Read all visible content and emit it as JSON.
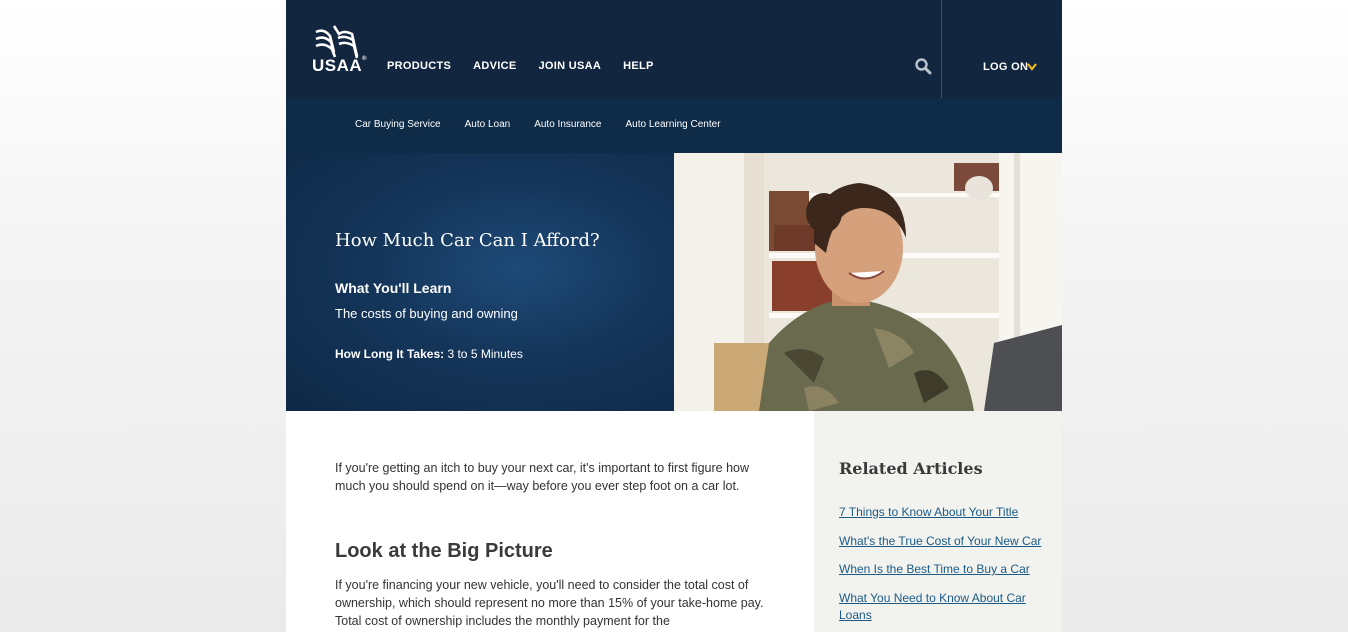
{
  "brand": {
    "name": "USAA",
    "registered": "®"
  },
  "header": {
    "nav": [
      "PRODUCTS",
      "ADVICE",
      "JOIN USAA",
      "HELP"
    ],
    "search_icon": "search-icon",
    "logon_label": "LOG ON",
    "accent": "#f2b71e"
  },
  "subnav": {
    "items": [
      "Car Buying Service",
      "Auto Loan",
      "Auto Insurance",
      "Auto Learning Center"
    ]
  },
  "hero": {
    "title": "How Much Car Can I Afford?",
    "learn_heading": "What You'll Learn",
    "learn_text": "The costs of buying and owning",
    "time_label": "How Long It Takes:",
    "time_value": "3 to 5 Minutes"
  },
  "article": {
    "intro": "If you're getting an itch to buy your next car, it's important to first figure how much you should spend on it—way before you ever step foot on a car lot.",
    "section_heading": "Look at the Big Picture",
    "section_text": "If you're financing your new vehicle, you'll need to consider the total cost of ownership, which should represent no more than 15% of your take-home pay. Total cost of ownership includes the monthly payment for the"
  },
  "related": {
    "heading": "Related Articles",
    "links": [
      "7 Things to Know About Your Title",
      "What's the True Cost of Your New Car",
      "When Is the Best Time to Buy a Car",
      "What You Need to Know About Car Loans"
    ]
  },
  "colors": {
    "header_bg": "#12263f",
    "subnav_bg": "#0e2b48",
    "link": "#1c5b87"
  }
}
